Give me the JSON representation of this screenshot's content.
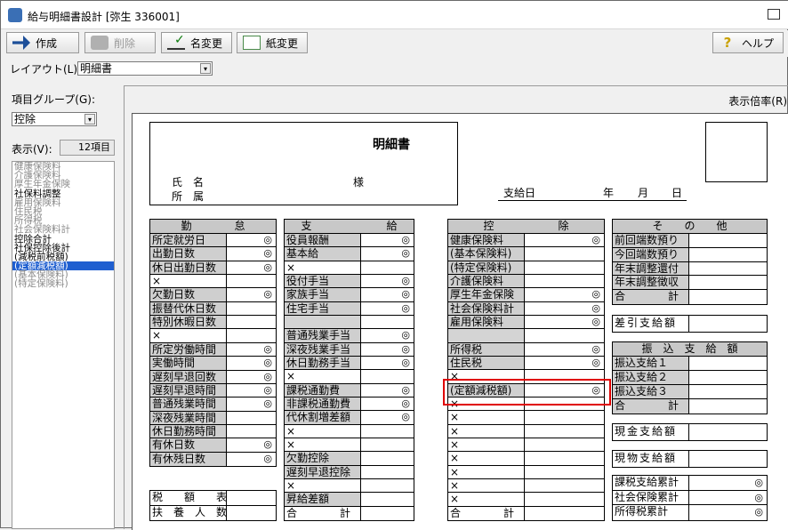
{
  "window": {
    "title": "給与明細書設計 [弥生 336001]"
  },
  "toolbar": {
    "create": "作成",
    "delete": "削除",
    "rename": "名変更",
    "paper": "紙変更",
    "help": "ヘルプ"
  },
  "layout": {
    "label": "レイアウト(L):",
    "value": "明細書"
  },
  "group": {
    "label": "項目グループ(G):",
    "value": "控除",
    "display_label": "表示(V):",
    "count": "12項目"
  },
  "group_items": [
    {
      "label": "健康保険料",
      "state": "gray"
    },
    {
      "label": "介護保険料",
      "state": "gray"
    },
    {
      "label": "厚生年金保険",
      "state": "gray"
    },
    {
      "label": "社保料調整",
      "state": "black"
    },
    {
      "label": "雇用保険料",
      "state": "gray"
    },
    {
      "label": "住民税",
      "state": "gray"
    },
    {
      "label": "所得税",
      "state": "gray"
    },
    {
      "label": "社会保険料計",
      "state": "gray"
    },
    {
      "label": "控除合計",
      "state": "black"
    },
    {
      "label": "社保控除後計",
      "state": "black"
    },
    {
      "label": "(減税前税額)",
      "state": "black"
    },
    {
      "label": "(定額減税額)",
      "state": "selected"
    },
    {
      "label": "(基本保険料)",
      "state": "gray"
    },
    {
      "label": "(特定保険料)",
      "state": "gray"
    }
  ],
  "zoom_label": "表示倍率(R)",
  "doc": {
    "title": "明細書",
    "name_label": "氏　名",
    "dept_label": "所　属",
    "sama": "様",
    "pay_date": "支給日",
    "year": "年",
    "month": "月",
    "day": "日"
  },
  "mark": "◎",
  "x_mark": "×",
  "kintai": {
    "header": "勤　　　　怠",
    "rows": [
      {
        "label": "所定就労日",
        "mark": true
      },
      {
        "label": "出勤日数",
        "mark": true
      },
      {
        "label": "休日出勤日数",
        "mark": true
      },
      {
        "label": "×",
        "x": true
      },
      {
        "label": "欠勤日数",
        "mark": true
      },
      {
        "label": "振替代休日数",
        "mark": false
      },
      {
        "label": "特別休暇日数",
        "mark": false
      },
      {
        "label": "×",
        "x": true
      },
      {
        "label": "所定労働時間",
        "mark": true
      },
      {
        "label": "実働時間",
        "mark": true
      },
      {
        "label": "遅刻早退回数",
        "mark": true
      },
      {
        "label": "遅刻早退時間",
        "mark": true
      },
      {
        "label": "普通残業時間",
        "mark": true
      },
      {
        "label": "深夜残業時間",
        "mark": false
      },
      {
        "label": "休日勤務時間",
        "mark": false
      },
      {
        "label": "有休日数",
        "mark": true
      },
      {
        "label": "有休残日数",
        "mark": true
      }
    ]
  },
  "zeigaku": {
    "row1": "税　　額　　表",
    "row2": "扶　養　人　数"
  },
  "shikyu": {
    "header": "支　　　　　　　給",
    "total": "合　　　　計",
    "rows": [
      {
        "label": "役員報酬",
        "mark": true
      },
      {
        "label": "基本給",
        "mark": true
      },
      {
        "label": "×",
        "x": true
      },
      {
        "label": "役付手当",
        "mark": true
      },
      {
        "label": "家族手当",
        "mark": true
      },
      {
        "label": "住宅手当",
        "mark": true
      },
      {
        "label": "",
        "mark": false,
        "blank": true
      },
      {
        "label": "普通残業手当",
        "mark": true
      },
      {
        "label": "深夜残業手当",
        "mark": true
      },
      {
        "label": "休日勤務手当",
        "mark": true
      },
      {
        "label": "×",
        "x": true
      },
      {
        "label": "課税通勤費",
        "mark": true
      },
      {
        "label": "非課税通勤費",
        "mark": true
      },
      {
        "label": "代休割増差額",
        "mark": true
      },
      {
        "label": "×",
        "x": true
      },
      {
        "label": "×",
        "x": true
      },
      {
        "label": "欠勤控除",
        "mark": false
      },
      {
        "label": "遅刻早退控除",
        "mark": false
      },
      {
        "label": "×",
        "x": true
      },
      {
        "label": "昇給差額",
        "mark": false
      }
    ]
  },
  "kojo": {
    "header": "控　　　　　　除",
    "total": "合　　　　計",
    "rows": [
      {
        "label": "健康保険料",
        "mark": true
      },
      {
        "label": "(基本保険料)",
        "mark": false
      },
      {
        "label": "(特定保険料)",
        "mark": false
      },
      {
        "label": "介護保険料",
        "mark": false
      },
      {
        "label": "厚生年金保険",
        "mark": true
      },
      {
        "label": "社会保険料計",
        "mark": true
      },
      {
        "label": "雇用保険料",
        "mark": true
      },
      {
        "label": "",
        "mark": false,
        "blank": true
      },
      {
        "label": "所得税",
        "mark": true
      },
      {
        "label": "住民税",
        "mark": true
      },
      {
        "label": "×",
        "x": true
      },
      {
        "label": "(定額減税額)",
        "mark": true
      },
      {
        "label": "×",
        "x": true
      },
      {
        "label": "×",
        "x": true
      },
      {
        "label": "×",
        "x": true
      },
      {
        "label": "×",
        "x": true
      },
      {
        "label": "×",
        "x": true
      },
      {
        "label": "×",
        "x": true
      },
      {
        "label": "×",
        "x": true
      },
      {
        "label": "×",
        "x": true
      }
    ]
  },
  "sonota": {
    "header": "そ　　の　　他",
    "rows": [
      {
        "label": "前回端数預り"
      },
      {
        "label": "今回端数預り"
      },
      {
        "label": "年末調整還付"
      },
      {
        "label": "年末調整徴収"
      },
      {
        "label": "合　　　　計"
      }
    ]
  },
  "sashihiki": "差引支給額",
  "furikomi": {
    "header": "振　込　支　給　額",
    "rows": [
      {
        "label": "振込支給１"
      },
      {
        "label": "振込支給２"
      },
      {
        "label": "振込支給３"
      },
      {
        "label": "合　　　　計"
      }
    ]
  },
  "genkin": "現金支給額",
  "genbutsu": "現物支給額",
  "ruikei": [
    {
      "label": "課税支給累計"
    },
    {
      "label": "社会保険累計"
    },
    {
      "label": "所得税累計"
    }
  ]
}
